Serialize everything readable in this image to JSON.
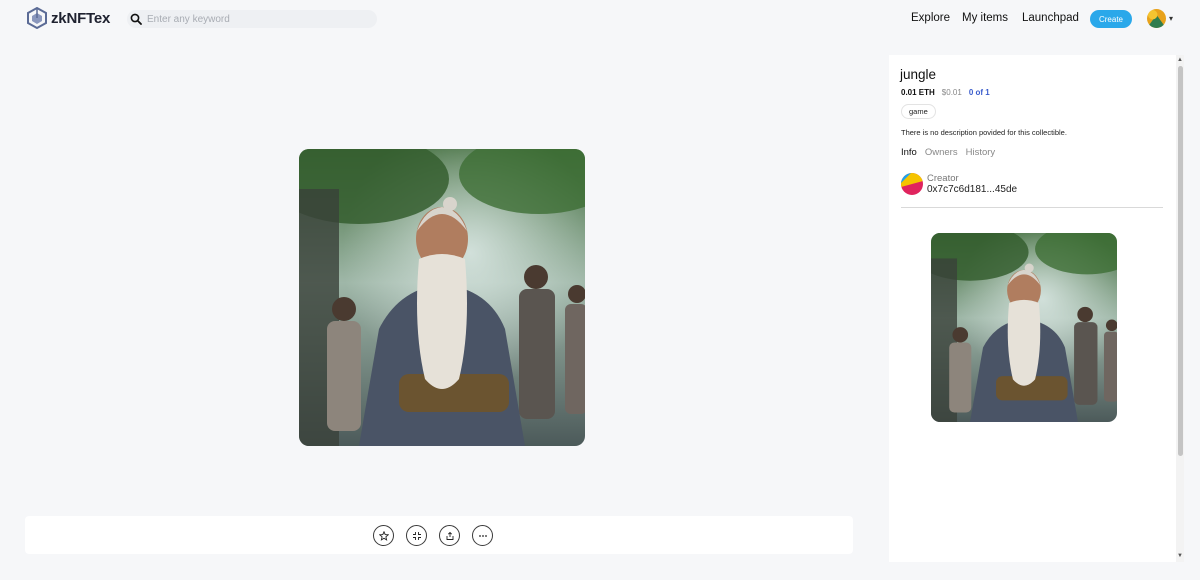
{
  "app": {
    "name": "zkNFTex"
  },
  "search": {
    "placeholder": "Enter any keyword"
  },
  "nav": {
    "explore": "Explore",
    "my_items": "My items",
    "launchpad": "Launchpad",
    "create": "Create"
  },
  "colors": {
    "accent": "#2aa8ea",
    "count_link": "#3a5ccc"
  },
  "item": {
    "title": "jungle",
    "price_eth": "0.01 ETH",
    "price_usd": "$0.01",
    "edition_count": "0 of 1",
    "tag": "game",
    "description": "There is no description povided for this collectible."
  },
  "tabs": [
    {
      "label": "Info",
      "active": true
    },
    {
      "label": "Owners",
      "active": false
    },
    {
      "label": "History",
      "active": false
    }
  ],
  "creator": {
    "label": "Creator",
    "address": "0x7c7c6d181...45de"
  },
  "actions": [
    {
      "icon": "star-icon"
    },
    {
      "icon": "fullscreen-icon"
    },
    {
      "icon": "share-icon"
    },
    {
      "icon": "more-icon"
    }
  ]
}
